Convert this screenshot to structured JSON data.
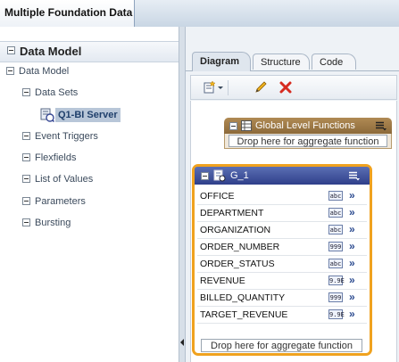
{
  "app": {
    "tab_title": "Multiple Foundation Data"
  },
  "left_panel": {
    "header": "Data Model",
    "tree": {
      "root": "Data Model",
      "data_sets": "Data Sets",
      "selected_dataset": "Q1-BI Server",
      "event_triggers": "Event Triggers",
      "flexfields": "Flexfields",
      "list_of_values": "List of Values",
      "parameters": "Parameters",
      "bursting": "Bursting"
    }
  },
  "tabs": [
    {
      "label": "Diagram",
      "active": true
    },
    {
      "label": "Structure",
      "active": false
    },
    {
      "label": "Code",
      "active": false
    }
  ],
  "toolbar": {
    "icons": [
      "new-dataset-icon",
      "dropdown-icon",
      "edit-pencil-icon",
      "delete-x-icon"
    ]
  },
  "global_functions": {
    "title": "Global Level Functions",
    "drop_text": "Drop here for aggregate function"
  },
  "group": {
    "title": "G_1",
    "columns": [
      {
        "name": "OFFICE",
        "type": "abc"
      },
      {
        "name": "DEPARTMENT",
        "type": "abc"
      },
      {
        "name": "ORGANIZATION",
        "type": "abc"
      },
      {
        "name": "ORDER_NUMBER",
        "type": "999"
      },
      {
        "name": "ORDER_STATUS",
        "type": "abc"
      },
      {
        "name": "REVENUE",
        "type": "9.9E"
      },
      {
        "name": "BILLED_QUANTITY",
        "type": "999"
      },
      {
        "name": "TARGET_REVENUE",
        "type": "9.9E"
      }
    ],
    "drop_text": "Drop here for aggregate function"
  },
  "colors": {
    "group_border": "#f0a21f",
    "group_header": "#3a4b96",
    "global_header": "#9c7845",
    "selection": "#b8c6d8"
  }
}
